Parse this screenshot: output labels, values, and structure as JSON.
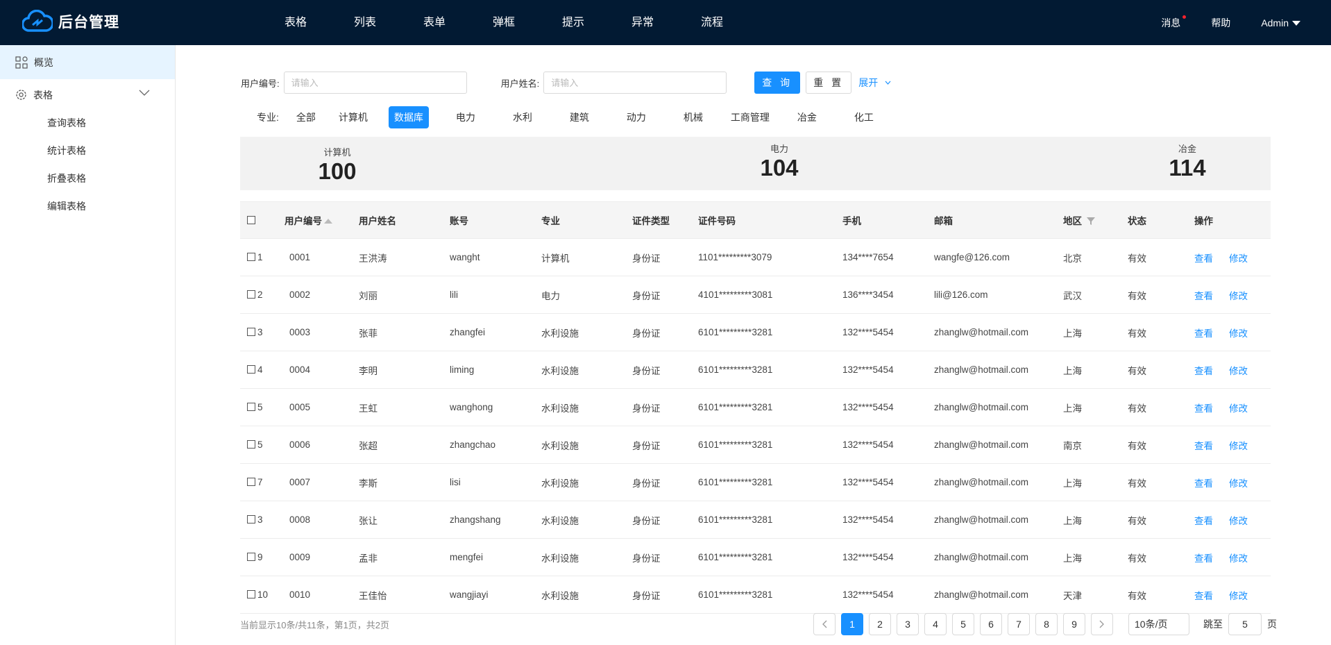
{
  "header": {
    "brand": "后台管理",
    "nav": [
      "表格",
      "列表",
      "表单",
      "弹框",
      "提示",
      "异常",
      "流程"
    ],
    "messages": "消息",
    "help": "帮助",
    "user": "Admin"
  },
  "sidebar": {
    "overview": "概览",
    "group": "表格",
    "items": [
      "查询表格",
      "统计表格",
      "折叠表格",
      "编辑表格"
    ]
  },
  "filters": {
    "user_id_label": "用户编号:",
    "user_id_placeholder": "请输入",
    "user_name_label": "用户姓名:",
    "user_name_placeholder": "请输入",
    "query": "查 询",
    "reset": "重 置",
    "expand": "展开"
  },
  "majors": {
    "label": "专业:",
    "items": [
      "全部",
      "计算机",
      "数据库",
      "电力",
      "水利",
      "建筑",
      "动力",
      "机械",
      "工商管理",
      "冶金",
      "化工"
    ],
    "active": "数据库"
  },
  "stats": [
    {
      "label": "计算机",
      "value": "100"
    },
    {
      "label": "电力",
      "value": "104"
    },
    {
      "label": "冶金",
      "value": "114"
    }
  ],
  "table": {
    "columns": [
      "用户编号",
      "用户姓名",
      "账号",
      "专业",
      "证件类型",
      "证件号码",
      "手机",
      "邮箱",
      "地区",
      "状态",
      "操作"
    ],
    "view": "查看",
    "edit": "修改",
    "rows": [
      {
        "n": "1",
        "id": "0001",
        "name": "王洪涛",
        "account": "wanght",
        "major": "计算机",
        "idtype": "身份证",
        "idno": "1101*********3079",
        "phone": "134****7654",
        "email": "wangfe@126.com",
        "region": "北京",
        "status": "有效"
      },
      {
        "n": "2",
        "id": "0002",
        "name": "刘丽",
        "account": "lili",
        "major": "电力",
        "idtype": "身份证",
        "idno": "4101*********3081",
        "phone": "136****3454",
        "email": "lili@126.com",
        "region": "武汉",
        "status": "有效"
      },
      {
        "n": "3",
        "id": "0003",
        "name": "张菲",
        "account": "zhangfei",
        "major": "水利设施",
        "idtype": "身份证",
        "idno": "6101*********3281",
        "phone": "132****5454",
        "email": "zhanglw@hotmail.com",
        "region": "上海",
        "status": "有效"
      },
      {
        "n": "4",
        "id": "0004",
        "name": "李明",
        "account": "liming",
        "major": "水利设施",
        "idtype": "身份证",
        "idno": "6101*********3281",
        "phone": "132****5454",
        "email": "zhanglw@hotmail.com",
        "region": "上海",
        "status": "有效"
      },
      {
        "n": "5",
        "id": "0005",
        "name": "王虹",
        "account": "wanghong",
        "major": "水利设施",
        "idtype": "身份证",
        "idno": "6101*********3281",
        "phone": "132****5454",
        "email": "zhanglw@hotmail.com",
        "region": "上海",
        "status": "有效"
      },
      {
        "n": "5",
        "id": "0006",
        "name": "张超",
        "account": "zhangchao",
        "major": "水利设施",
        "idtype": "身份证",
        "idno": "6101*********3281",
        "phone": "132****5454",
        "email": "zhanglw@hotmail.com",
        "region": "南京",
        "status": "有效"
      },
      {
        "n": "7",
        "id": "0007",
        "name": "李斯",
        "account": "lisi",
        "major": "水利设施",
        "idtype": "身份证",
        "idno": "6101*********3281",
        "phone": "132****5454",
        "email": "zhanglw@hotmail.com",
        "region": "上海",
        "status": "有效"
      },
      {
        "n": "3",
        "id": "0008",
        "name": "张让",
        "account": "zhangshang",
        "major": "水利设施",
        "idtype": "身份证",
        "idno": "6101*********3281",
        "phone": "132****5454",
        "email": "zhanglw@hotmail.com",
        "region": "上海",
        "status": "有效"
      },
      {
        "n": "9",
        "id": "0009",
        "name": "孟非",
        "account": "mengfei",
        "major": "水利设施",
        "idtype": "身份证",
        "idno": "6101*********3281",
        "phone": "132****5454",
        "email": "zhanglw@hotmail.com",
        "region": "上海",
        "status": "有效"
      },
      {
        "n": "10",
        "id": "0010",
        "name": "王佳怡",
        "account": "wangjiayi",
        "major": "水利设施",
        "idtype": "身份证",
        "idno": "6101*********3281",
        "phone": "132****5454",
        "email": "zhanglw@hotmail.com",
        "region": "天津",
        "status": "有效"
      }
    ]
  },
  "pagination": {
    "info": "当前显示10条/共11条，第1页，共2页",
    "pages": [
      "1",
      "2",
      "3",
      "4",
      "5",
      "6",
      "7",
      "8",
      "9"
    ],
    "current": "1",
    "page_size": "10条/页",
    "jump_label": "跳至",
    "jump_value": "5",
    "page_suffix": "页"
  },
  "colors": {
    "primary": "#1890ff",
    "header_bg": "#021a33"
  }
}
